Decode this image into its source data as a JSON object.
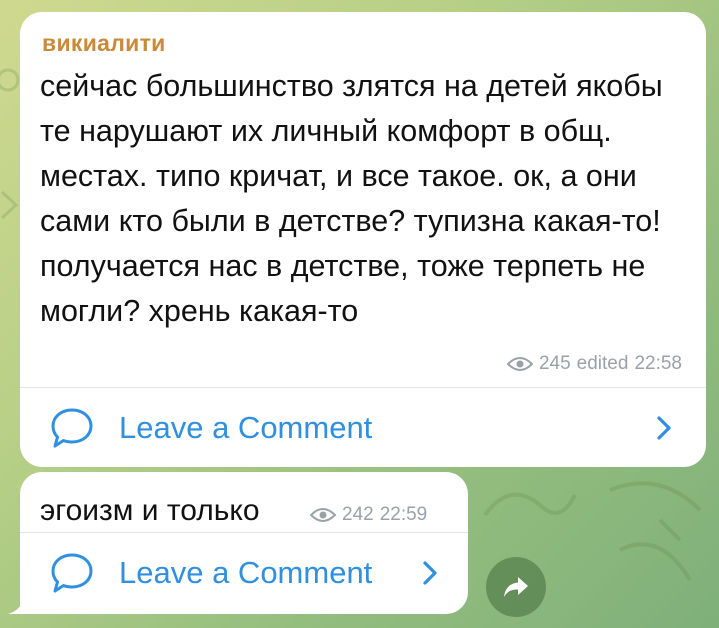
{
  "messages": [
    {
      "sender": "викиалити",
      "text": "сейчас большинство злятся на детей якобы те нарушают их личный комфорт в общ. местах. типо кричат, и все такое. ок, а они сами кто были в детстве? тупизна какая-то! получается нас в детстве, тоже терпеть не могли? хрень какая-то",
      "views": "245",
      "edited_label": "edited",
      "time": "22:58",
      "comment_label": "Leave a Comment"
    },
    {
      "text": "эгоизм и только",
      "views": "242",
      "time": "22:59",
      "comment_label": "Leave a Comment"
    }
  ],
  "colors": {
    "sender": "#c98a3a",
    "link": "#2f8fe0",
    "meta": "#9aa2a7"
  },
  "icons": {
    "views": "eye-icon",
    "comment": "comment-bubble-icon",
    "chevron": "chevron-right-icon",
    "share": "share-arrow-icon"
  }
}
